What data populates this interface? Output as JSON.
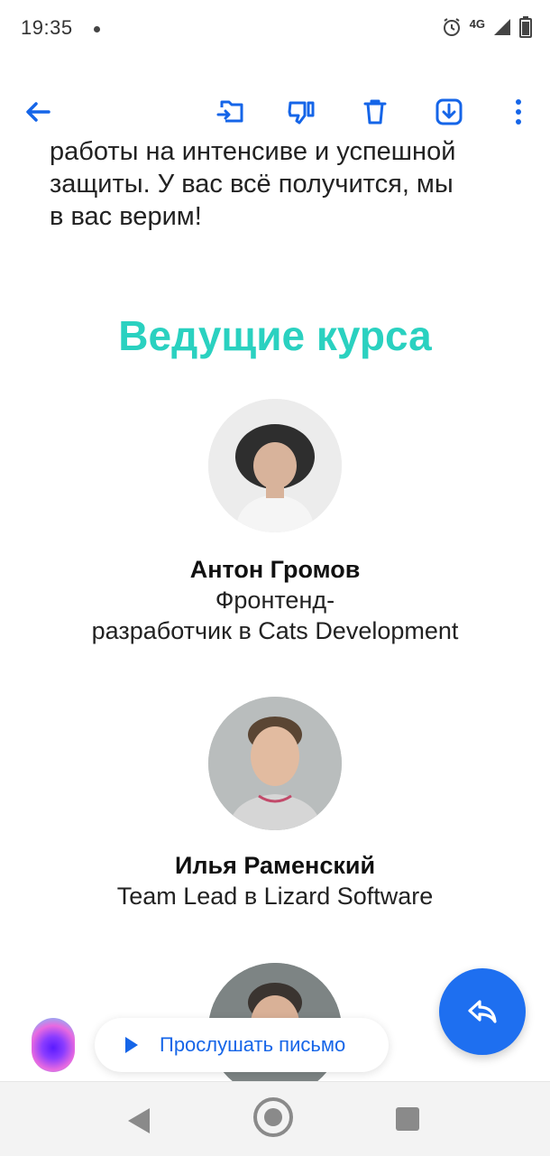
{
  "status_bar": {
    "time": "19:35",
    "network": "4G",
    "icons": [
      "alarm-icon",
      "signal-icon",
      "battery-icon"
    ]
  },
  "toolbar": {
    "buttons": [
      "back-arrow-icon",
      "move-to-folder-icon",
      "dislike-icon",
      "trash-icon",
      "download-icon",
      "more-vert-icon"
    ]
  },
  "email": {
    "intro_lines": [
      "работы на интенсиве и успешной",
      "защиты. У вас всё получится, мы",
      "в вас верим!"
    ],
    "section_title": "Ведущие курса",
    "speakers": [
      {
        "name": "Антон Громов",
        "role_line1": "Фронтенд-",
        "role_line2": "разработчик в Cats Development"
      },
      {
        "name": "Илья Раменский",
        "role_line1": "Team Lead в Lizard Software",
        "role_line2": ""
      }
    ]
  },
  "listen_button": {
    "label": "Прослушать письмо"
  },
  "colors": {
    "accent": "#1e6ff0",
    "title": "#2ad1c0",
    "link": "#1565e8"
  }
}
